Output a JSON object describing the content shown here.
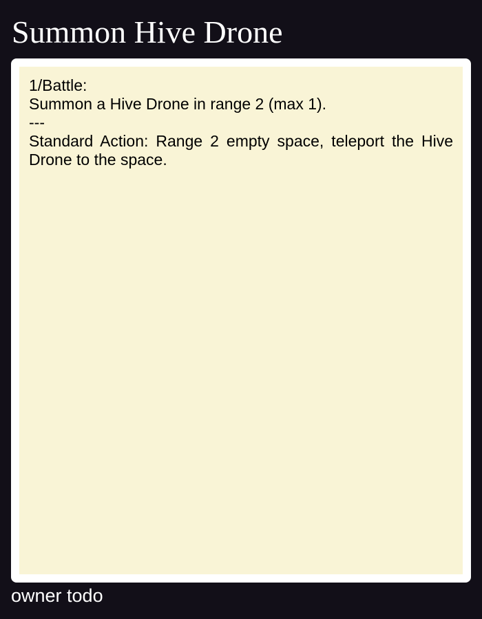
{
  "card": {
    "title": "Summon Hive Drone",
    "body": {
      "frequency": "1/Battle:",
      "effect": "Summon a Hive Drone in range 2 (max 1).",
      "separator": "---",
      "action": "Standard Action: Range 2 empty space, teleport the Hive Drone to the space."
    },
    "owner": "owner todo"
  },
  "colors": {
    "background": "#120f18",
    "frame": "#ffffff",
    "body": "#f9f4d6",
    "text": "#000000",
    "title": "#ffffff"
  }
}
